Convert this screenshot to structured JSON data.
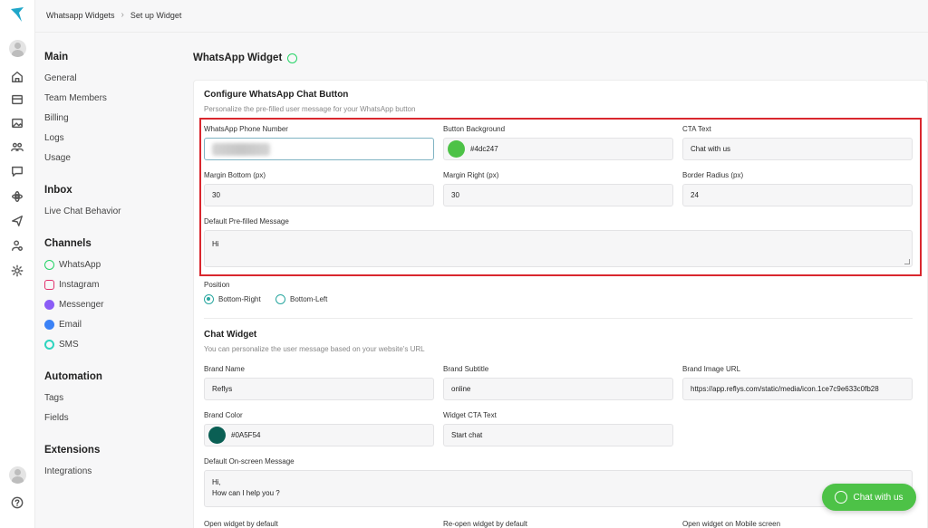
{
  "breadcrumb": {
    "parent": "Whatsapp Widgets",
    "current": "Set up Widget"
  },
  "nav": {
    "main": {
      "title": "Main",
      "items": [
        "General",
        "Team Members",
        "Billing",
        "Logs",
        "Usage"
      ]
    },
    "inbox": {
      "title": "Inbox",
      "items": [
        "Live Chat Behavior"
      ]
    },
    "channels": {
      "title": "Channels",
      "items": [
        {
          "label": "WhatsApp",
          "color": "#25d366"
        },
        {
          "label": "Instagram",
          "color": "#e1306c"
        },
        {
          "label": "Messenger",
          "color": "#8a5cf6"
        },
        {
          "label": "Email",
          "color": "#3b82f6"
        },
        {
          "label": "SMS",
          "color": "#2dd4bf"
        }
      ]
    },
    "automation": {
      "title": "Automation",
      "items": [
        "Tags",
        "Fields"
      ]
    },
    "extensions": {
      "title": "Extensions",
      "items": [
        "Integrations"
      ]
    }
  },
  "page": {
    "title": "WhatsApp Widget"
  },
  "configure": {
    "title": "Configure WhatsApp Chat Button",
    "subtitle": "Personalize the pre-filled user message for your WhatsApp button",
    "phone_label": "WhatsApp Phone Number",
    "bg_label": "Button Background",
    "bg_value": "#4dc247",
    "cta_label": "CTA Text",
    "cta_value": "Chat with us",
    "mb_label": "Margin Bottom (px)",
    "mb_value": "30",
    "mr_label": "Margin Right (px)",
    "mr_value": "30",
    "br_label": "Border Radius (px)",
    "br_value": "24",
    "msg_label": "Default Pre-filled Message",
    "msg_value": "Hi",
    "position_label": "Position",
    "position_options": [
      "Bottom-Right",
      "Bottom-Left"
    ],
    "position_selected": "Bottom-Right"
  },
  "chat_widget": {
    "title": "Chat Widget",
    "subtitle": "You can personalize the user message based on your website's URL",
    "brand_name_label": "Brand Name",
    "brand_name_value": "Reflys",
    "brand_subtitle_label": "Brand Subtitle",
    "brand_subtitle_value": "online",
    "brand_image_label": "Brand Image URL",
    "brand_image_value": "https://app.reflys.com/static/media/icon.1ce7c9e633c0fb28",
    "brand_color_label": "Brand Color",
    "brand_color_value": "#0A5F54",
    "widget_cta_label": "Widget CTA Text",
    "widget_cta_value": "Start chat",
    "onscreen_label": "Default On-screen Message",
    "onscreen_line1": "Hi,",
    "onscreen_line2": "How can I help you ?",
    "open_default_label": "Open widget by default",
    "reopen_label": "Re-open widget by default",
    "mobile_label": "Open widget on Mobile screen"
  },
  "fab": {
    "label": "Chat with us"
  },
  "colors": {
    "accent": "#2aa7a0",
    "whatsapp": "#4dc247",
    "brand": "#0A5F54",
    "highlight": "#d9272e"
  }
}
